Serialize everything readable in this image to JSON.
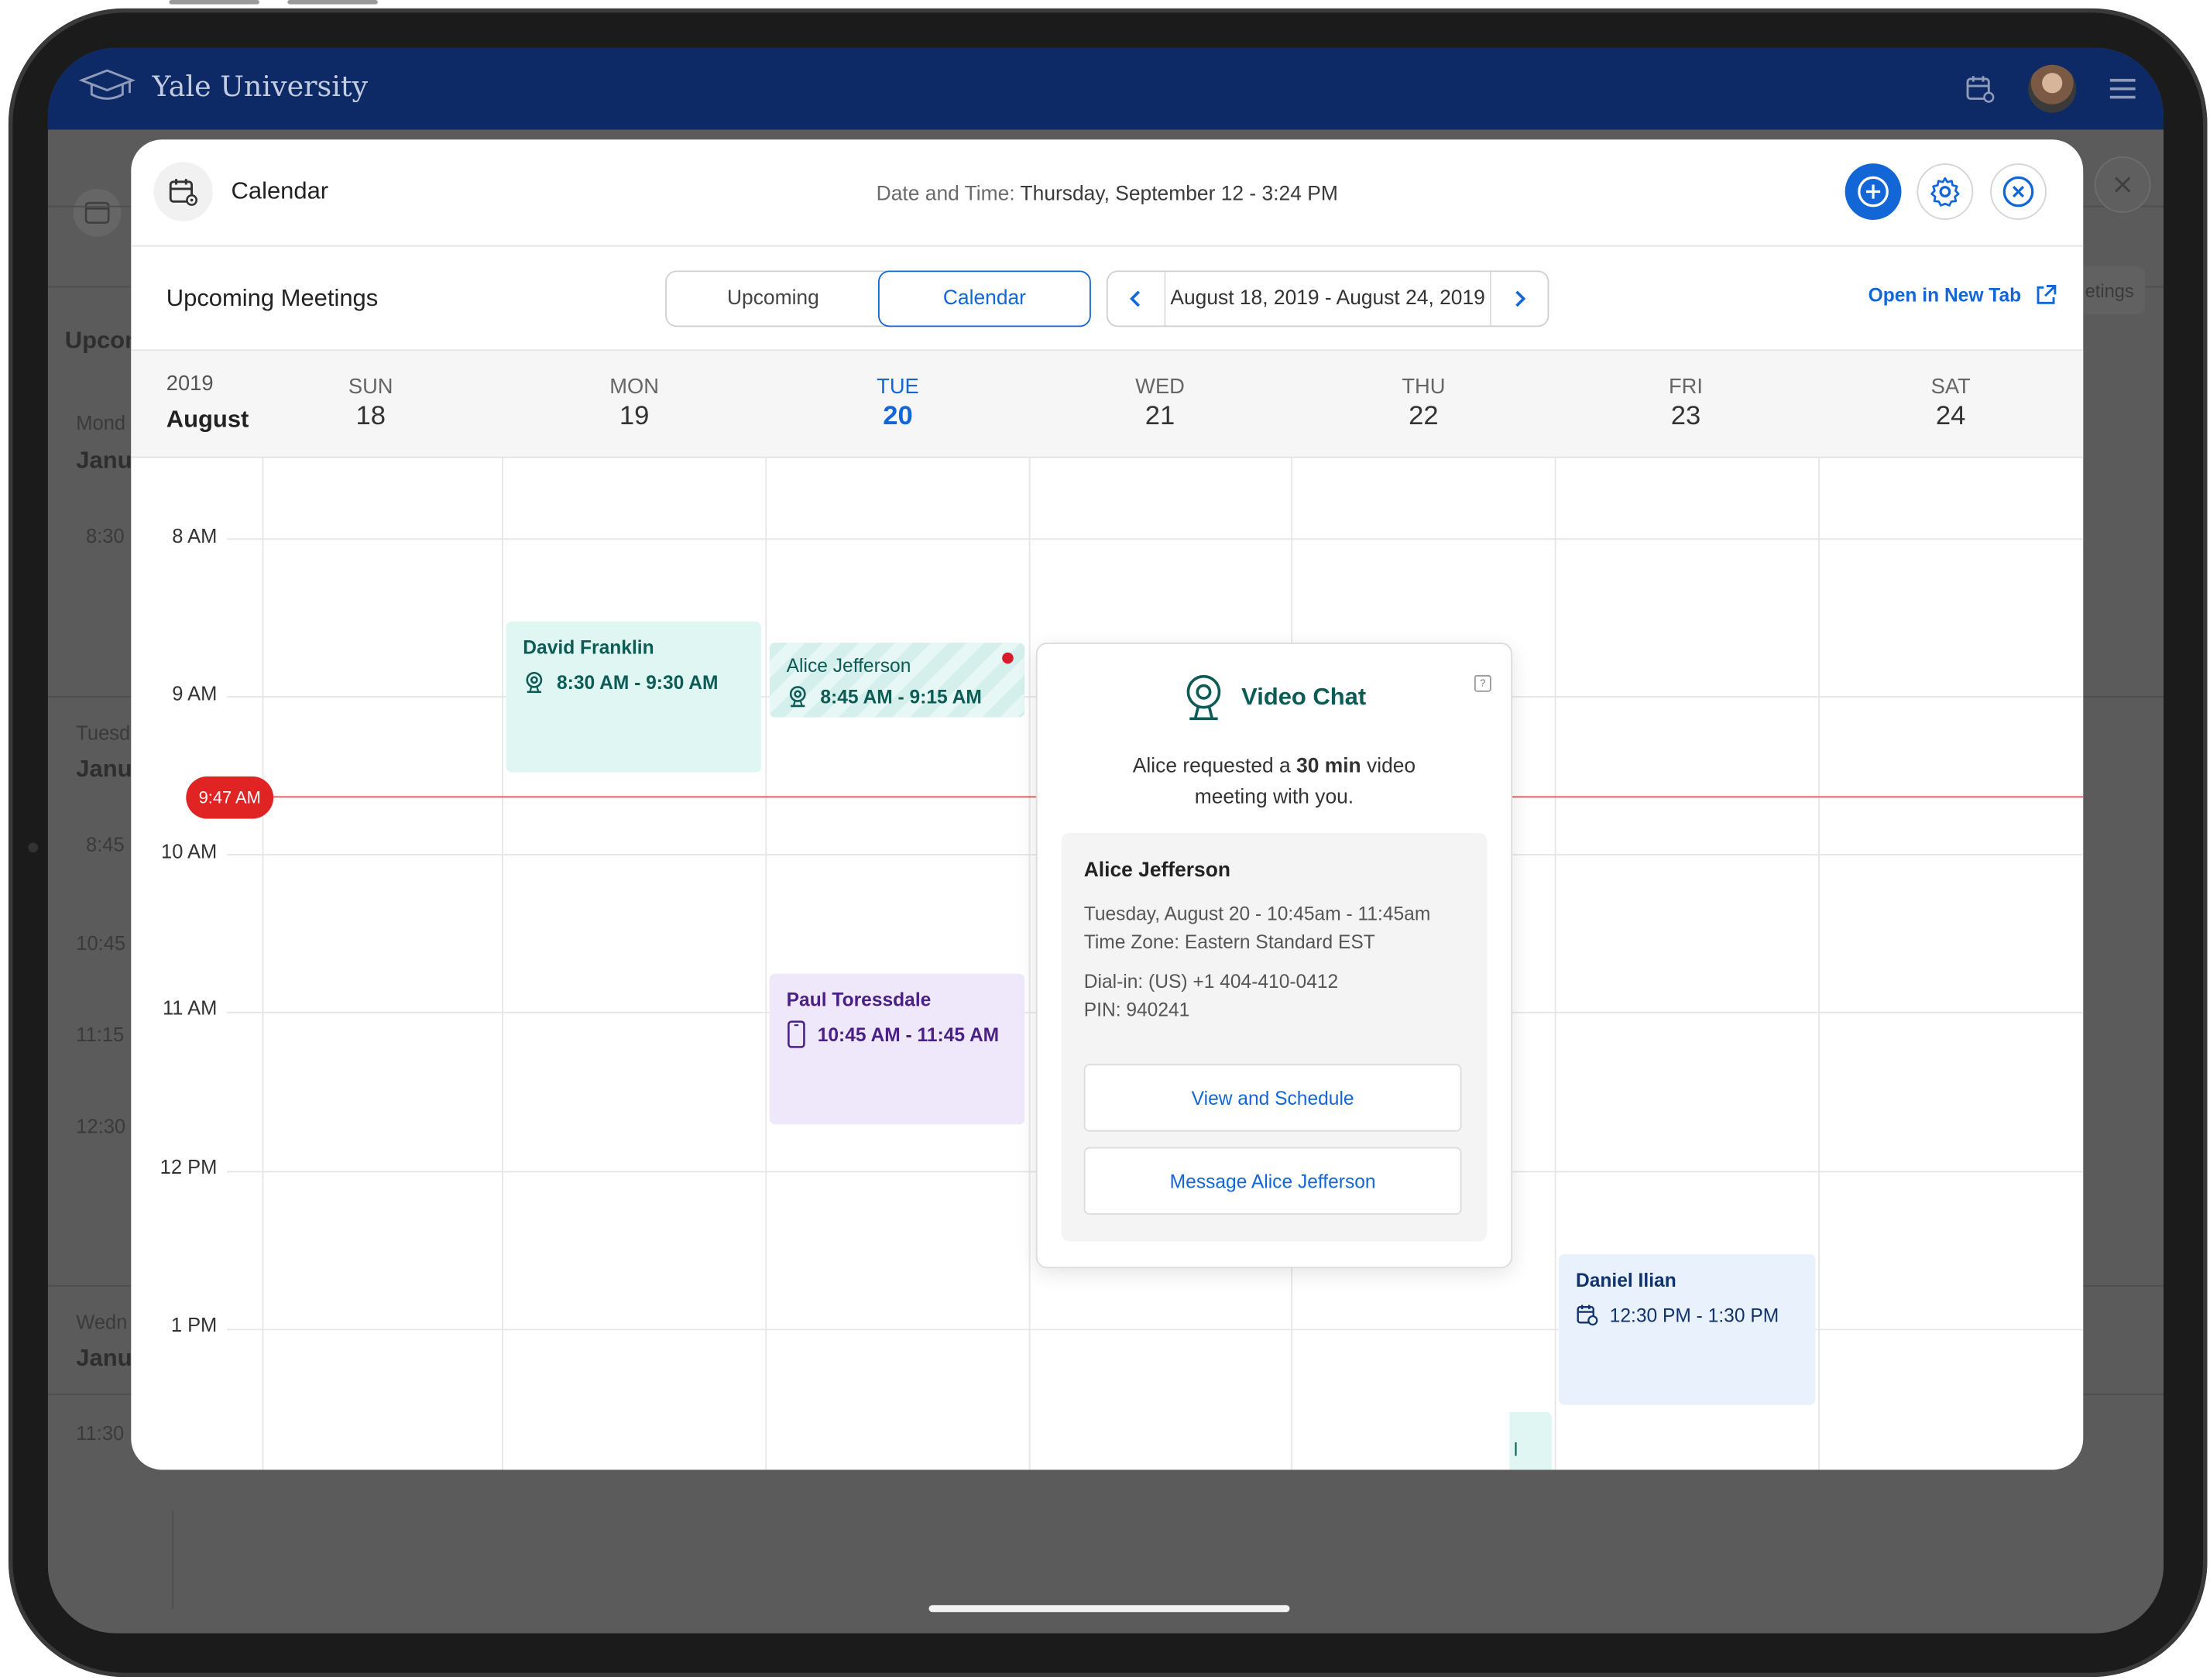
{
  "app": {
    "name": "Yale University"
  },
  "background_page": {
    "section_title": "Upcom",
    "days": [
      {
        "weekday": "Mond",
        "date": "Janua"
      },
      {
        "weekday": "Tuesd",
        "date": "Janua"
      },
      {
        "weekday": "Wedn",
        "date": "Janua"
      }
    ],
    "times": [
      "8:30",
      "8:45",
      "10:45",
      "11:15",
      "12:30",
      "11:30"
    ],
    "button_partial": "etings"
  },
  "modal": {
    "title": "Calendar",
    "datetime_label": "Date and Time:",
    "datetime_value": "Thursday, September 12 - 3:24 PM",
    "icons": {
      "primary": "add-icon",
      "settings": "gear-icon",
      "close": "close-circle-icon",
      "calendar": "calendar-settings-icon"
    }
  },
  "toolbar": {
    "title": "Upcoming Meetings",
    "tabs": [
      {
        "label": "Upcoming",
        "active": false
      },
      {
        "label": "Calendar",
        "active": true
      }
    ],
    "range": "August 18, 2019 - August 24, 2019",
    "open_in_new_tab": "Open in New Tab"
  },
  "calendar": {
    "year": "2019",
    "month": "August",
    "days": [
      {
        "weekday": "SUN",
        "date": "18",
        "today": false
      },
      {
        "weekday": "MON",
        "date": "19",
        "today": false
      },
      {
        "weekday": "TUE",
        "date": "20",
        "today": true
      },
      {
        "weekday": "WED",
        "date": "21",
        "today": false
      },
      {
        "weekday": "THU",
        "date": "22",
        "today": false
      },
      {
        "weekday": "FRI",
        "date": "23",
        "today": false
      },
      {
        "weekday": "SAT",
        "date": "24",
        "today": false
      }
    ],
    "time_labels": [
      "8 AM",
      "9 AM",
      "10 AM",
      "11 AM",
      "12 PM",
      "1 PM"
    ],
    "now_label": "9:47 AM",
    "events": [
      {
        "name": "David Franklin",
        "time": "8:30 AM - 9:30 AM",
        "icon": "video-chat-icon"
      },
      {
        "name": "Alice Jefferson",
        "time": "8:45 AM - 9:15 AM",
        "icon": "video-chat-icon"
      },
      {
        "name": "Paul Toressdale",
        "time": "10:45 AM - 11:45 AM",
        "icon": "phone-icon"
      },
      {
        "name": "Daniel Ilian",
        "time": "12:30 PM - 1:30 PM",
        "icon": "calendar-icon"
      }
    ],
    "hidden_event_fragment": "l"
  },
  "popover": {
    "title": "Video Chat",
    "message_before": "Alice requested a ",
    "message_duration": "30 min",
    "message_after": " video meeting with you.",
    "card": {
      "name": "Alice Jefferson",
      "when": "Tuesday, August 20 - 10:45am - 11:45am",
      "timezone": "Time Zone: Eastern Standard EST",
      "dial_in": "Dial-in: (US) +1 404-410-0412",
      "pin": "PIN: 940241"
    },
    "buttons": {
      "view": "View and Schedule",
      "message": "Message Alice Jefferson"
    }
  },
  "colors": {
    "accent": "#1366d6",
    "app_bar": "#0e2a66",
    "now_line": "#e02424",
    "video_event": "#dff6f3",
    "phone_event": "#efe8fb",
    "calendar_event": "#e8f1fc"
  }
}
